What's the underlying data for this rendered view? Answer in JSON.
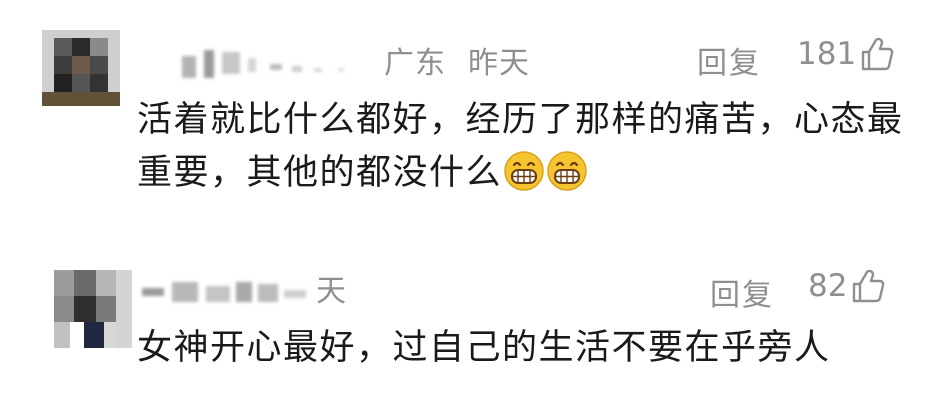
{
  "comments": [
    {
      "location": "广东",
      "time": "昨天",
      "reply_label": "回复",
      "likes": "181",
      "text_line1": "活着就比什么都好，经历了那样的痛苦，心态最",
      "text_line2": "重要，其他的都没什么"
    },
    {
      "time_partial": "天",
      "reply_label": "回复",
      "likes": "82",
      "text_line1": "女神开心最好，过自己的生活不要在乎旁人"
    }
  ],
  "colors": {
    "meta_gray": "#8f8f8f",
    "text": "#1a1a1a",
    "emoji_yellow": "#f6c431"
  },
  "icons": {
    "like": "thumbs-up-outline-icon",
    "emoji": "grinning-face-emoji-icon"
  }
}
